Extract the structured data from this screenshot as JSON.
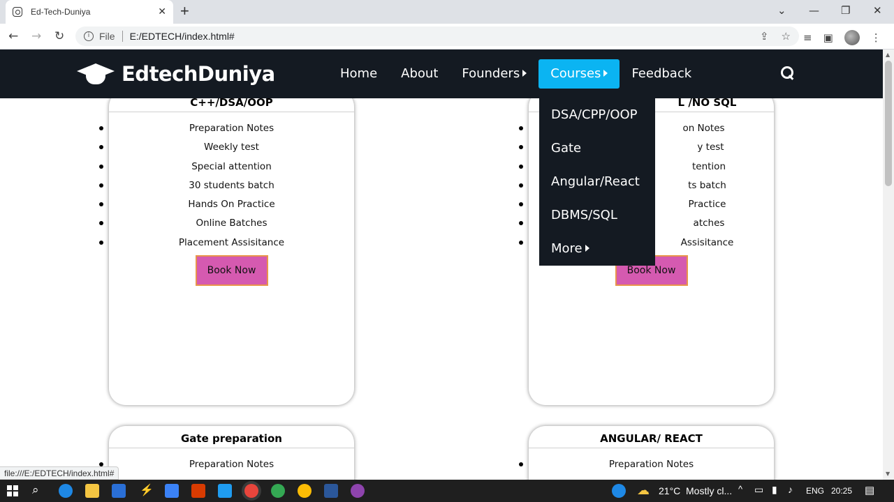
{
  "browser": {
    "tab_title": "Ed-Tech-Duniya",
    "tab_close": "✕",
    "new_tab": "+",
    "back": "←",
    "forward": "→",
    "reload": "↻",
    "info": "i",
    "file_label": "File",
    "url": "E:/EDTECH/index.html#",
    "status_url": "file:///E:/EDTECH/index.html#"
  },
  "site": {
    "logo_text": "EdtechDuniya",
    "nav": {
      "home": "Home",
      "about": "About",
      "founders": "Founders",
      "courses": "Courses",
      "feedback": "Feedback"
    },
    "courses_menu": [
      "DSA/CPP/OOP",
      "Gate",
      "Angular/React",
      "DBMS/SQL",
      "More"
    ],
    "cards": [
      {
        "title": "C++/DSA/OOP",
        "features": [
          "Preparation Notes",
          "Weekly test",
          "Special attention",
          "30 students batch",
          "Hands On Practice",
          "Online Batches",
          "Placement Assisitance"
        ],
        "button": "Book Now"
      },
      {
        "title": "L /NO SQL",
        "features": [
          "on Notes",
          "y test",
          "tention",
          "ts batch",
          "Practice",
          "atches",
          "Assisitance"
        ],
        "button": "Book Now"
      },
      {
        "title": "Gate preparation",
        "features": [
          "Preparation Notes"
        ]
      },
      {
        "title": "ANGULAR/ REACT",
        "features": [
          "Preparation Notes"
        ]
      }
    ]
  },
  "taskbar": {
    "temperature": "21°C",
    "weather": "Mostly cl...",
    "language": "ENG",
    "time": "20:25"
  },
  "colors": {
    "navbar_bg": "#141a22",
    "active_nav": "#0bb4f2",
    "button_bg": "#d55ab0",
    "button_border": "#e8954a"
  }
}
